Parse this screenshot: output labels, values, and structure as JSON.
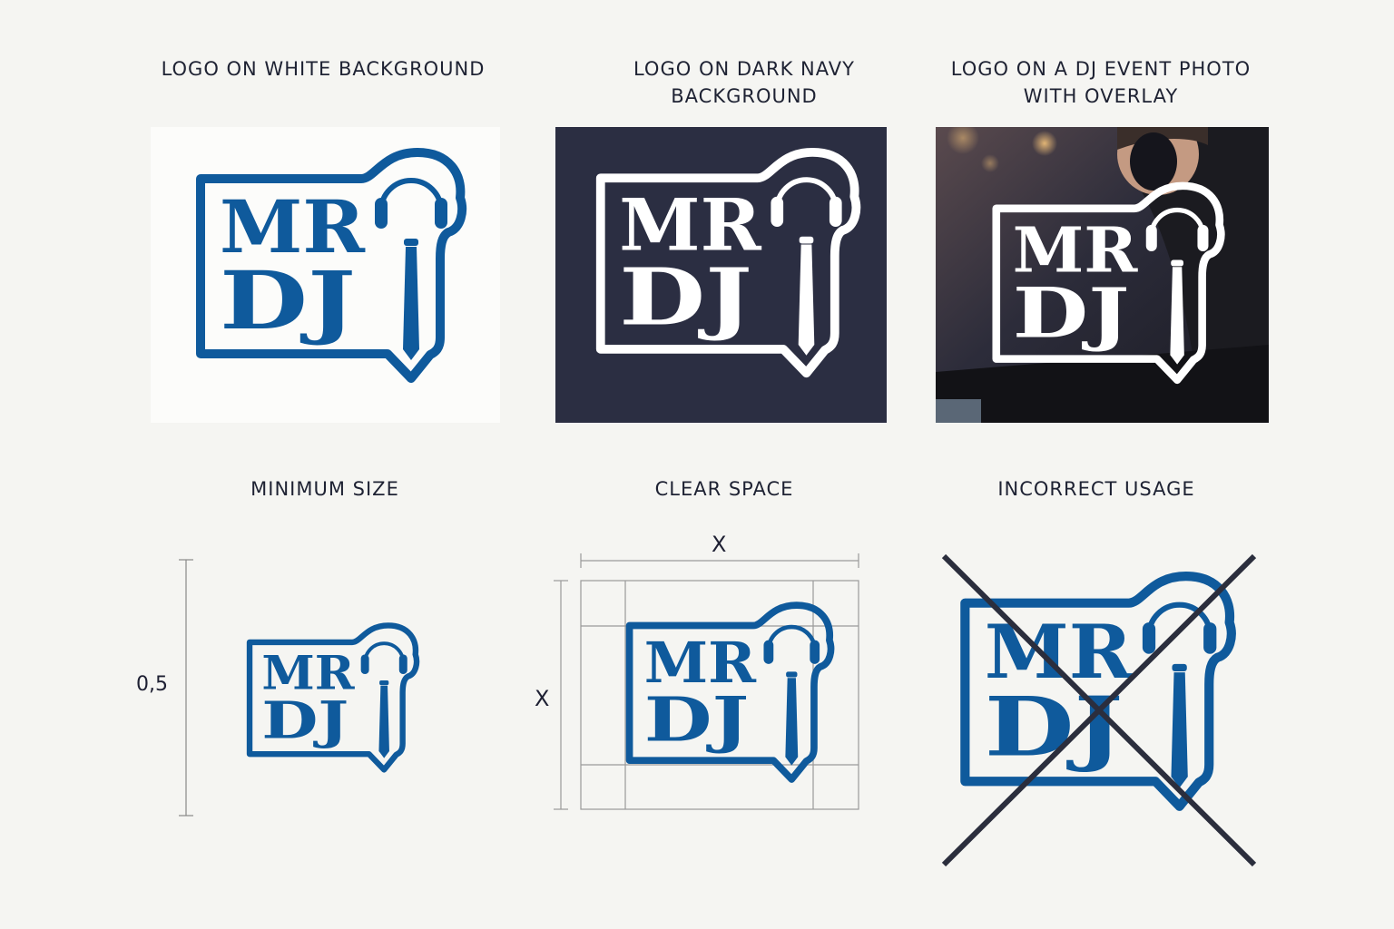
{
  "sections": {
    "white": {
      "title": "LOGO ON WHITE BACKGROUND"
    },
    "navy": {
      "title_line1": "LOGO ON DARK NAVY",
      "title_line2": "BACKGROUND"
    },
    "photo": {
      "title_line1": "LOGO ON A DJ EVENT PHOTO",
      "title_line2": "WITH OVERLAY"
    },
    "minimum": {
      "title": "MINIMUM SIZE",
      "dimension_label": "0,5"
    },
    "clearspace": {
      "title": "CLEAR SPACE",
      "width_label": "X",
      "height_label": "X"
    },
    "incorrect": {
      "title": "INCORRECT USAGE"
    }
  },
  "logo": {
    "line1": "MR",
    "line2": "DJ"
  },
  "colors": {
    "brand_blue": "#0f5a9c",
    "navy": "#2b2e42",
    "page_bg": "#f5f5f2",
    "cross": "#2b2e3d"
  }
}
